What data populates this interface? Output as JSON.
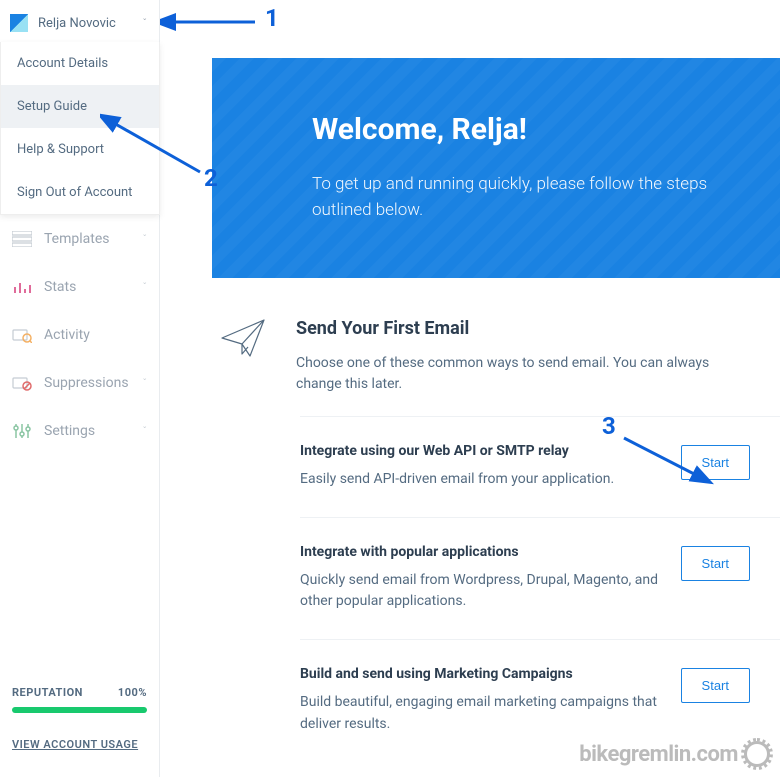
{
  "user": {
    "name": "Relja Novovic"
  },
  "dropdown": {
    "items": [
      {
        "label": "Account Details"
      },
      {
        "label": "Setup Guide"
      },
      {
        "label": "Help & Support"
      },
      {
        "label": "Sign Out of Account"
      }
    ]
  },
  "nav": {
    "items": [
      {
        "label": "Templates",
        "has_chevron": true
      },
      {
        "label": "Stats",
        "has_chevron": true
      },
      {
        "label": "Activity",
        "has_chevron": false
      },
      {
        "label": "Suppressions",
        "has_chevron": true
      },
      {
        "label": "Settings",
        "has_chevron": true
      }
    ]
  },
  "reputation": {
    "label": "REPUTATION",
    "value": "100%"
  },
  "usage_link": "VIEW ACCOUNT USAGE",
  "hero": {
    "title": "Welcome, Relja!",
    "subtitle": "To get up and running quickly, please follow the steps outlined below."
  },
  "section": {
    "title": "Send Your First Email",
    "description": "Choose one of these common ways to send email. You can always change this later."
  },
  "tasks": [
    {
      "title": "Integrate using our Web API or SMTP relay",
      "description": "Easily send API-driven email from your application.",
      "button": "Start"
    },
    {
      "title": "Integrate with popular applications",
      "description": "Quickly send email from Wordpress, Drupal, Magento, and other popular applications.",
      "button": "Start"
    },
    {
      "title": "Build and send using Marketing Campaigns",
      "description": "Build beautiful, engaging email marketing campaigns that deliver results.",
      "button": "Start"
    }
  ],
  "annotations": {
    "n1": "1",
    "n2": "2",
    "n3": "3"
  },
  "watermark": "bikegremlin.com"
}
